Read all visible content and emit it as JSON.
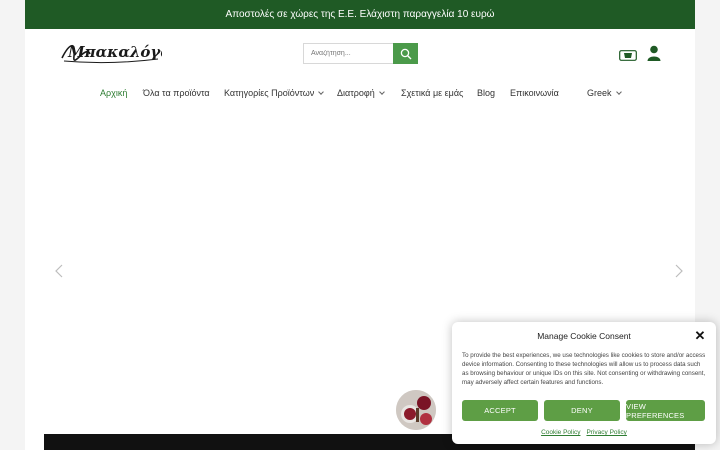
{
  "topbar": {
    "text": "Αποστολές σε χώρες της Ε.Ε. Ελάχιστη παραγγελία 10 ευρώ"
  },
  "logo": {
    "text": "Μπακαλόγατος"
  },
  "search": {
    "placeholder": "Αναζήτηση..."
  },
  "nav": {
    "items": [
      {
        "label": "Αρχική"
      },
      {
        "label": "Όλα τα προϊόντα"
      },
      {
        "label": "Κατηγορίες Προϊόντων"
      },
      {
        "label": "Διατροφή"
      },
      {
        "label": "Σχετικά με εμάς"
      },
      {
        "label": "Blog"
      },
      {
        "label": "Επικοινωνία"
      },
      {
        "label": "Greek"
      }
    ]
  },
  "cookie": {
    "title": "Manage Cookie Consent",
    "text": "To provide the best experiences, we use technologies like cookies to store and/or access device information. Consenting to these technologies will allow us to process data such as browsing behaviour or unique IDs on this site. Not consenting or withdrawing consent, may adversely affect certain features and functions.",
    "accept": "ACCEPT",
    "deny": "DENY",
    "preferences": "VIEW PREFERENCES",
    "cookie_policy": "Cookie Policy",
    "privacy_policy": "Privacy Policy"
  },
  "colors": {
    "topbar_bg": "#1f5a25",
    "accent_green": "#5e9e45",
    "nav_active": "#2e7d32"
  },
  "icons": {
    "search": "search-icon",
    "cart": "basket-icon",
    "user": "user-icon",
    "close": "close-icon",
    "prev": "chevron-left-icon",
    "next": "chevron-right-icon"
  }
}
